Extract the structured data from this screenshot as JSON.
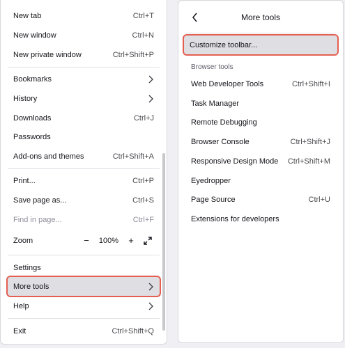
{
  "main_menu": {
    "new_tab": {
      "label": "New tab",
      "shortcut": "Ctrl+T"
    },
    "new_window": {
      "label": "New window",
      "shortcut": "Ctrl+N"
    },
    "new_private_window": {
      "label": "New private window",
      "shortcut": "Ctrl+Shift+P"
    },
    "bookmarks": {
      "label": "Bookmarks"
    },
    "history": {
      "label": "History"
    },
    "downloads": {
      "label": "Downloads",
      "shortcut": "Ctrl+J"
    },
    "passwords": {
      "label": "Passwords"
    },
    "addons": {
      "label": "Add-ons and themes",
      "shortcut": "Ctrl+Shift+A"
    },
    "print": {
      "label": "Print...",
      "shortcut": "Ctrl+P"
    },
    "save_page": {
      "label": "Save page as...",
      "shortcut": "Ctrl+S"
    },
    "find_in_page": {
      "label": "Find in page...",
      "shortcut": "Ctrl+F"
    },
    "zoom": {
      "label": "Zoom",
      "minus": "−",
      "value": "100%",
      "plus": "+",
      "fullscreen_icon": "fullscreen-icon"
    },
    "settings": {
      "label": "Settings"
    },
    "more_tools": {
      "label": "More tools"
    },
    "help": {
      "label": "Help"
    },
    "exit": {
      "label": "Exit",
      "shortcut": "Ctrl+Shift+Q"
    }
  },
  "more_tools_menu": {
    "title": "More tools",
    "customize_toolbar": {
      "label": "Customize toolbar..."
    },
    "section_label": "Browser tools",
    "web_dev_tools": {
      "label": "Web Developer Tools",
      "shortcut": "Ctrl+Shift+I"
    },
    "task_manager": {
      "label": "Task Manager"
    },
    "remote_debugging": {
      "label": "Remote Debugging"
    },
    "browser_console": {
      "label": "Browser Console",
      "shortcut": "Ctrl+Shift+J"
    },
    "responsive_design": {
      "label": "Responsive Design Mode",
      "shortcut": "Ctrl+Shift+M"
    },
    "eyedropper": {
      "label": "Eyedropper"
    },
    "page_source": {
      "label": "Page Source",
      "shortcut": "Ctrl+U"
    },
    "extensions_dev": {
      "label": "Extensions for developers"
    }
  },
  "colors": {
    "highlight_outline": "#e45f52",
    "highlight_bg": "#dedee3"
  }
}
